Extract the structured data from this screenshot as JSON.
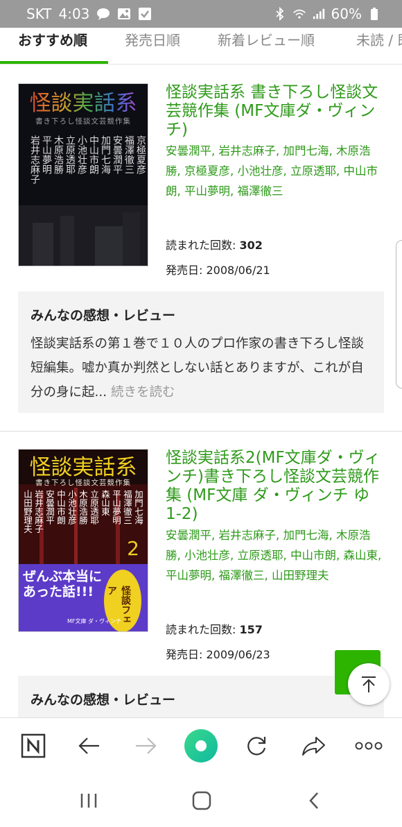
{
  "status": {
    "carrier": "SKT",
    "time": "4:03",
    "battery": "60%"
  },
  "tabs": [
    {
      "label": "おすすめ順",
      "active": true
    },
    {
      "label": "発売日順",
      "active": false
    },
    {
      "label": "新着レビュー順",
      "active": false
    },
    {
      "label": "未読 / 既",
      "active": false
    }
  ],
  "books": [
    {
      "cover": {
        "title": "怪談実話系",
        "subtitle": "書き下ろし怪談文芸競作集",
        "authors_vertical": [
          "京極夏彦",
          "福澤徹三",
          "安曇潤平",
          "加門七海",
          "中山市朗",
          "小池壮彦",
          "立原透耶",
          "木原浩勝",
          "平山夢明",
          "岩井志麻子"
        ]
      },
      "title": "怪談実話系 書き下ろし怪談文芸競作集 (MF文庫ダ・ヴィンチ)",
      "authors": "安曇潤平, 岩井志麻子, 加門七海, 木原浩勝, 京極夏彦, 小池壮彦, 立原透耶, 中山市朗, 平山夢明, 福澤徹三",
      "read_label": "読まれた回数:",
      "read_count": "302",
      "release_label": "発売日:",
      "release_date": "2008/06/21",
      "review_heading": "みんなの感想・レビュー",
      "review_text": "怪談実話系の第１巻で１０人のプロ作家の書き下ろし怪談短編集。嘘か真か判然としない話とありますが、これが自分の身に起...",
      "review_more": "続きを読む"
    },
    {
      "cover": {
        "title": "怪談実話系",
        "subtitle": "書き下ろし怪談文芸競作集",
        "number": "2",
        "authors_vertical": [
          "加門七海",
          "福澤徹三",
          "平山夢明",
          "森山東",
          "立原透耶",
          "木原浩勝",
          "小池壮彦",
          "中山市朗",
          "安曇潤平",
          "岩井志麻子",
          "山田野理夫"
        ],
        "band_text": "ぜんぶ本当にあった話!!!",
        "badge": "怪談フェア",
        "publisher": "MF文庫 ダ・ヴィンチ"
      },
      "title": "怪談実話系2(MF文庫ダ・ヴィンチ)書き下ろし怪談文芸競作集 (MF文庫 ダ・ヴィンチ ゆ 1-2)",
      "authors": "安曇潤平, 岩井志麻子, 加門七海, 木原浩勝, 小池壮彦, 立原透耶, 中山市朗, 森山東, 平山夢明, 福澤徹三, 山田野理夫",
      "read_label": "読まれた回数:",
      "read_count": "157",
      "release_label": "発売日:",
      "release_date": "2009/06/23",
      "review_heading": "みんなの感想・レビュー"
    }
  ],
  "colors": {
    "accent": "#2db400",
    "title_green": "#2e9a1a"
  }
}
